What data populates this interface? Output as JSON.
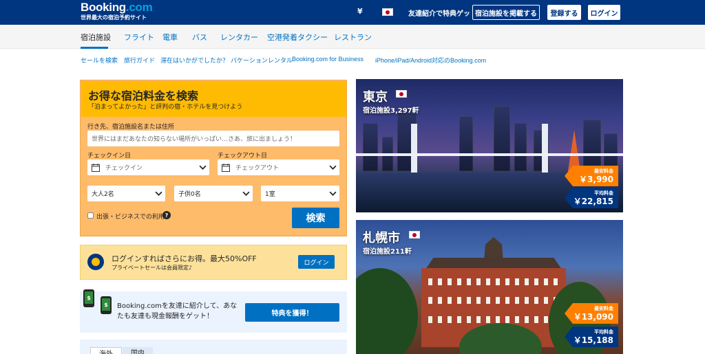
{
  "header": {
    "brand": "Booking",
    "brand_dot": ".com",
    "tagline": "世界最大の宿泊予約サイト",
    "currency": "¥",
    "invite": "友達紹介で特典ゲット",
    "list_property": "宿泊施設を掲載する",
    "register": "登録する",
    "login": "ログイン"
  },
  "nav": {
    "tabs": [
      "宿泊施設",
      "フライト",
      "電車",
      "バス",
      "レンタカー",
      "空港発着タクシー",
      "レストラン"
    ]
  },
  "sublinks": [
    "セールを検索",
    "旅行ガイド",
    "滞在はいかがでしたか？",
    "バケーションレンタル",
    "Booking.com for Business",
    "iPhone/iPad/Android対応のBooking.com"
  ],
  "search": {
    "title": "お得な宿泊料金を検索",
    "subtitle": "「泊まってよかった」と評判の宿・ホテルを見つけよう",
    "destination_label": "行き先、宿泊施設名または住所",
    "destination_placeholder": "世界にはまだあなたの知らない場所がいっぱい…さあ、旅に出ましょう！",
    "checkin_label": "チェックイン日",
    "checkin_placeholder": "チェックイン",
    "checkout_label": "チェックアウト日",
    "checkout_placeholder": "チェックアウト",
    "adults": "大人2名",
    "children": "子供0名",
    "rooms": "1室",
    "business_label": "出張・ビジネスでの利用",
    "help": "?",
    "submit": "検索"
  },
  "login_promo": {
    "title": "ログインすればさらにお得。最大50%OFF",
    "subtitle": "プライベートセールは会員限定♪",
    "button": "ログイン"
  },
  "referral": {
    "text": "Booking.comを友達に紹介して、あなたも友達も現金報酬をゲット！",
    "button": "特典を獲得！"
  },
  "destination_tabs": [
    "海外",
    "国内"
  ],
  "cities": [
    {
      "name": "東京",
      "count": "宿泊施設3,297軒",
      "min_label": "最安料金",
      "min_price": "￥3,990",
      "avg_label": "平均料金",
      "avg_price": "￥22,815"
    },
    {
      "name": "札幌市",
      "count": "宿泊施設211軒",
      "min_label": "最安料金",
      "min_price": "￥13,090",
      "avg_label": "平均料金",
      "avg_price": "￥15,188"
    }
  ],
  "colors": {
    "brand_blue": "#003580",
    "link_blue": "#0071c2",
    "search_yellow": "#febb02",
    "price_orange": "#ff8000"
  }
}
